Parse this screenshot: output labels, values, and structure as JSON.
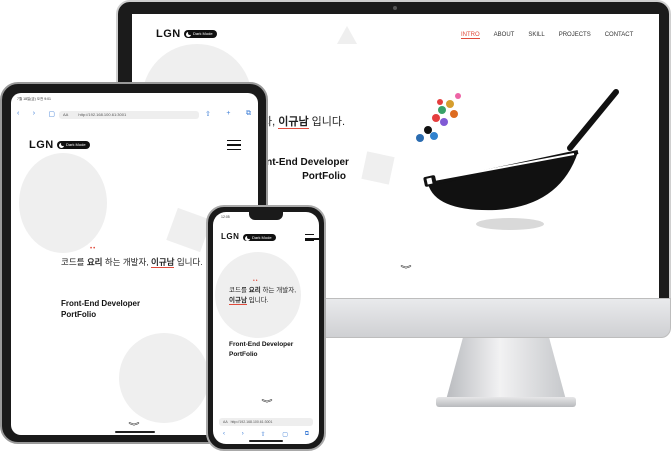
{
  "desktop": {
    "logo": "LGN",
    "dark_mode_label": "Dark Mode",
    "menu": [
      "INTRO",
      "ABOUT",
      "SKILL",
      "PROJECTS",
      "CONTACT"
    ],
    "hero_prefix": "자, ",
    "hero_name": "이규남",
    "hero_suffix": " 입니다.",
    "dev_line1": "Front-End Developer",
    "dev_line2": "PortFolio",
    "scroll_chevron": "︾"
  },
  "tablet": {
    "status": "7월 18일(금) 오전 9:01",
    "url": "http://192.168.100.61:3001",
    "aa": "AA",
    "logo": "LGN",
    "dark_mode_label": "Dark Mode",
    "hero_prefix": "코드를 ",
    "hero_cook": "요리",
    "hero_middle": " 하는 개발자, ",
    "hero_name": "이규남",
    "hero_suffix": " 입니다.",
    "dev_line1": "Front-End Developer",
    "dev_line2": "PortFolio",
    "scroll_chevron": "︾"
  },
  "phone": {
    "time": "12:05",
    "logo": "LGN",
    "dark_mode_label": "Dark Mode",
    "hero_prefix": "코드를 ",
    "hero_cook": "요리",
    "hero_middle": " 하는 개발자,",
    "hero_name": "이규남",
    "hero_suffix": " 입니다.",
    "dev_line1": "Front-End Developer",
    "dev_line2": "PortFolio",
    "scroll_chevron": "︾",
    "aa": "AA",
    "url": "http://192.168.100.61:3001"
  },
  "colors": {
    "accent": "#e04a3b",
    "frame": "#1a1a1a"
  }
}
